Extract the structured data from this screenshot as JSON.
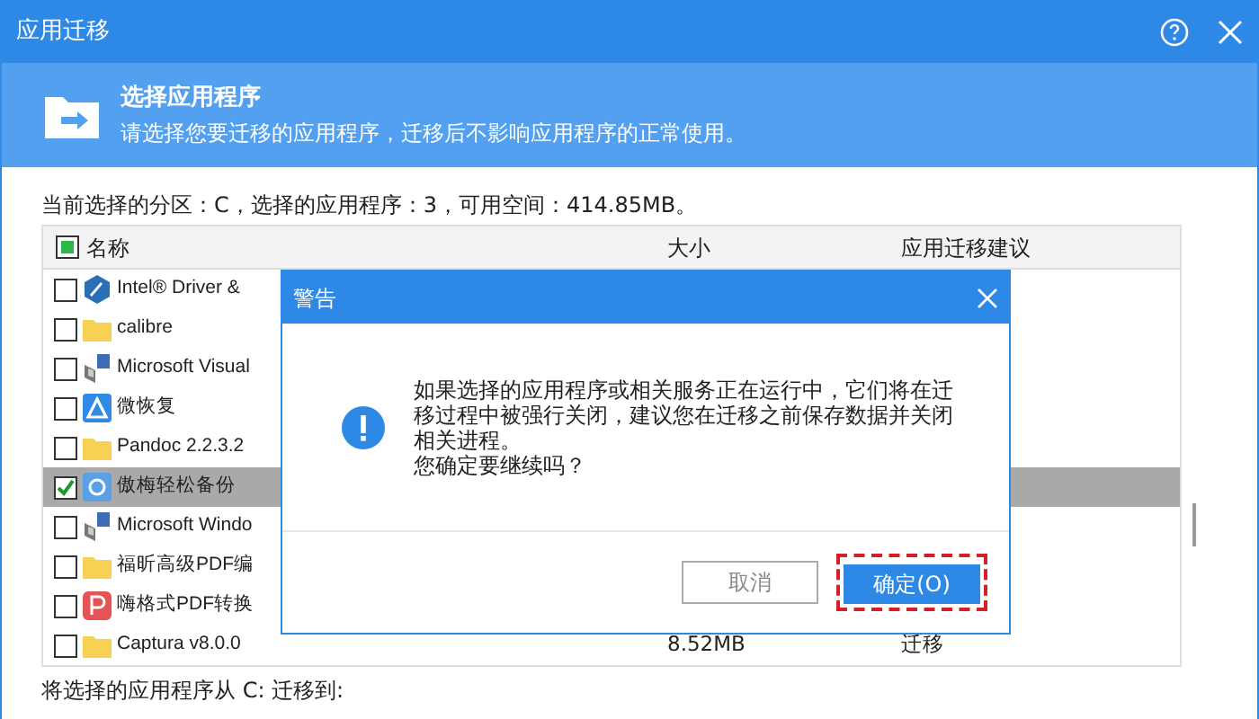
{
  "window": {
    "title": "应用迁移"
  },
  "header": {
    "title": "选择应用程序",
    "subtitle": "请选择您要迁移的应用程序，迁移后不影响应用程序的正常使用。"
  },
  "info": "当前选择的分区：C，选择的应用程序：3，可用空间：414.85MB。",
  "table": {
    "header_checkbox": {
      "mixed": true
    },
    "columns": [
      "名称",
      "大小",
      "应用迁移建议"
    ],
    "rows": [
      {
        "name": "Intel® Driver &",
        "kind": "intel",
        "checked": false,
        "selected": false
      },
      {
        "name": "calibre",
        "kind": "folder",
        "checked": false,
        "selected": false
      },
      {
        "name": "Microsoft Visual",
        "kind": "installer",
        "checked": false,
        "selected": false
      },
      {
        "name": "微恢复",
        "kind": "triangle",
        "checked": false,
        "selected": false
      },
      {
        "name": "Pandoc 2.2.3.2",
        "kind": "folder",
        "checked": false,
        "selected": false
      },
      {
        "name": "傲梅轻松备份",
        "kind": "sync",
        "checked": true,
        "selected": true
      },
      {
        "name": "Microsoft Windo",
        "kind": "installer",
        "checked": false,
        "selected": false
      },
      {
        "name": "福昕高级PDF编",
        "kind": "folder",
        "checked": false,
        "selected": false
      },
      {
        "name": "嗨格式PDF转换",
        "kind": "pdf",
        "checked": false,
        "selected": false
      },
      {
        "name": "Captura v8.0.0",
        "kind": "folder",
        "checked": false,
        "selected": false,
        "size": "8.52MB",
        "advice": "迁移"
      }
    ]
  },
  "footer": "将选择的应用程序从 C: 迁移到:",
  "dialog": {
    "title": "警告",
    "message": "如果选择的应用程序或相关服务正在运行中，它们将在迁移过程中被强行关闭，建议您在迁移之前保存数据并关闭相关进程。",
    "question": "您确定要继续吗？",
    "buttons": [
      {
        "label": "取消",
        "primary": false
      },
      {
        "label": "确定(O)",
        "primary": true
      }
    ]
  }
}
